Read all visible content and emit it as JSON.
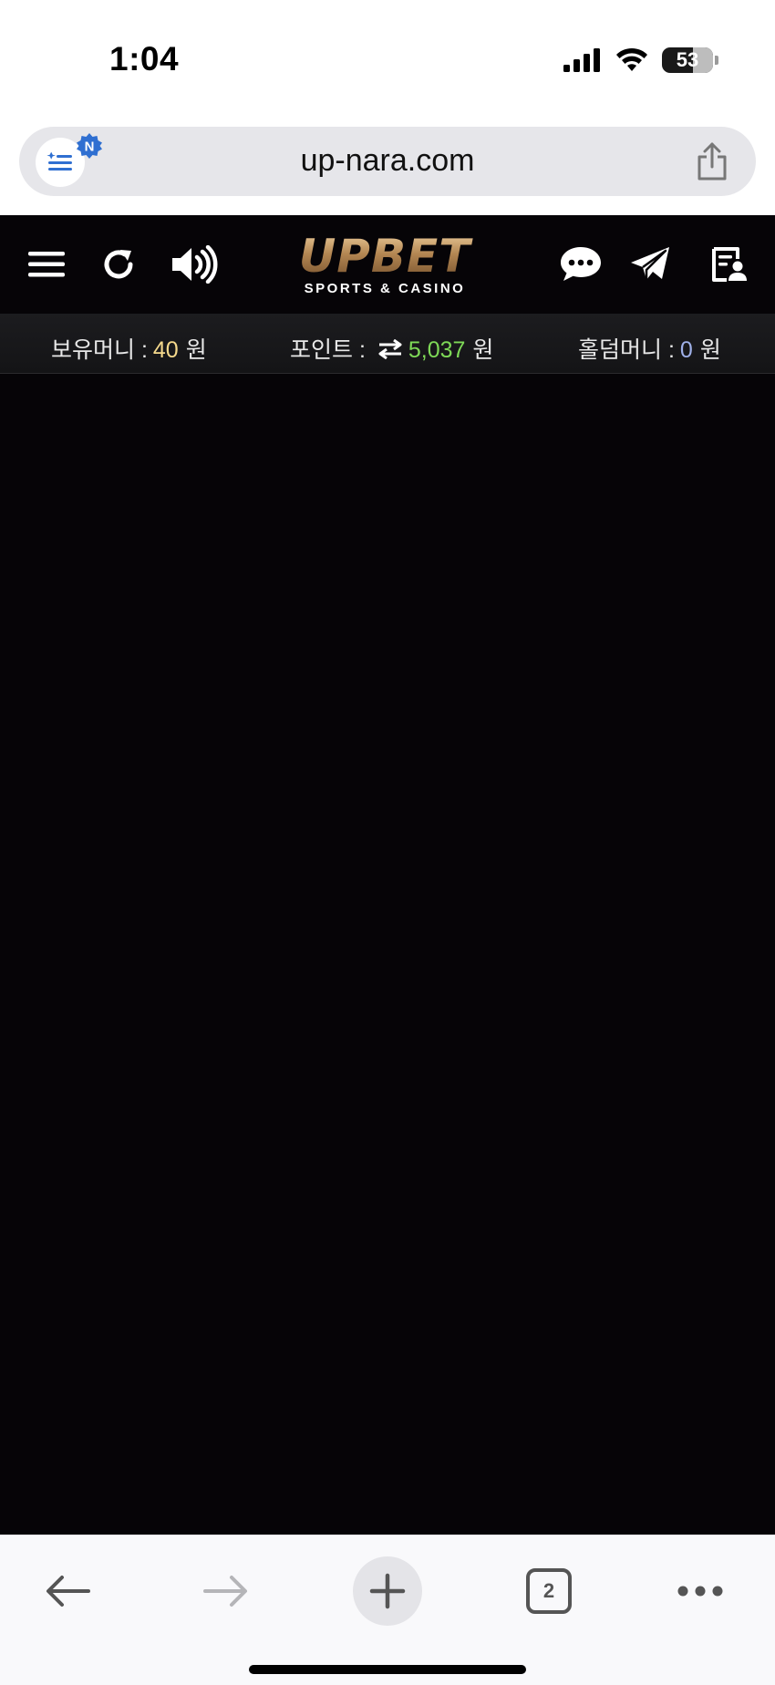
{
  "status_bar": {
    "time": "1:04",
    "battery": "53"
  },
  "browser": {
    "url": "up-nara.com",
    "reader_badge": "N",
    "tabs_count": "2"
  },
  "site": {
    "logo": {
      "main": "UPBET",
      "sub": "SPORTS & CASINO"
    },
    "balances": {
      "money": {
        "label": "보유머니 :",
        "value": "40",
        "unit": "원",
        "color": "#f5d98c"
      },
      "points": {
        "label": "포인트 :",
        "value": "5,037",
        "unit": "원",
        "color": "#7ed957"
      },
      "holdem": {
        "label": "홀덤머니 :",
        "value": "0",
        "unit": "원",
        "color": "#9fb0e8"
      }
    },
    "background": "#060407"
  },
  "icons": {
    "menu": "menu-icon",
    "refresh": "refresh-icon",
    "sound": "speaker-icon",
    "chat": "chat-icon",
    "telegram": "telegram-icon",
    "profile": "user-card-icon",
    "exchange": "exchange-icon",
    "back": "back-arrow-icon",
    "forward": "forward-arrow-icon",
    "new_tab": "plus-icon",
    "more": "more-icon",
    "share": "share-icon",
    "reader": "reader-icon"
  }
}
